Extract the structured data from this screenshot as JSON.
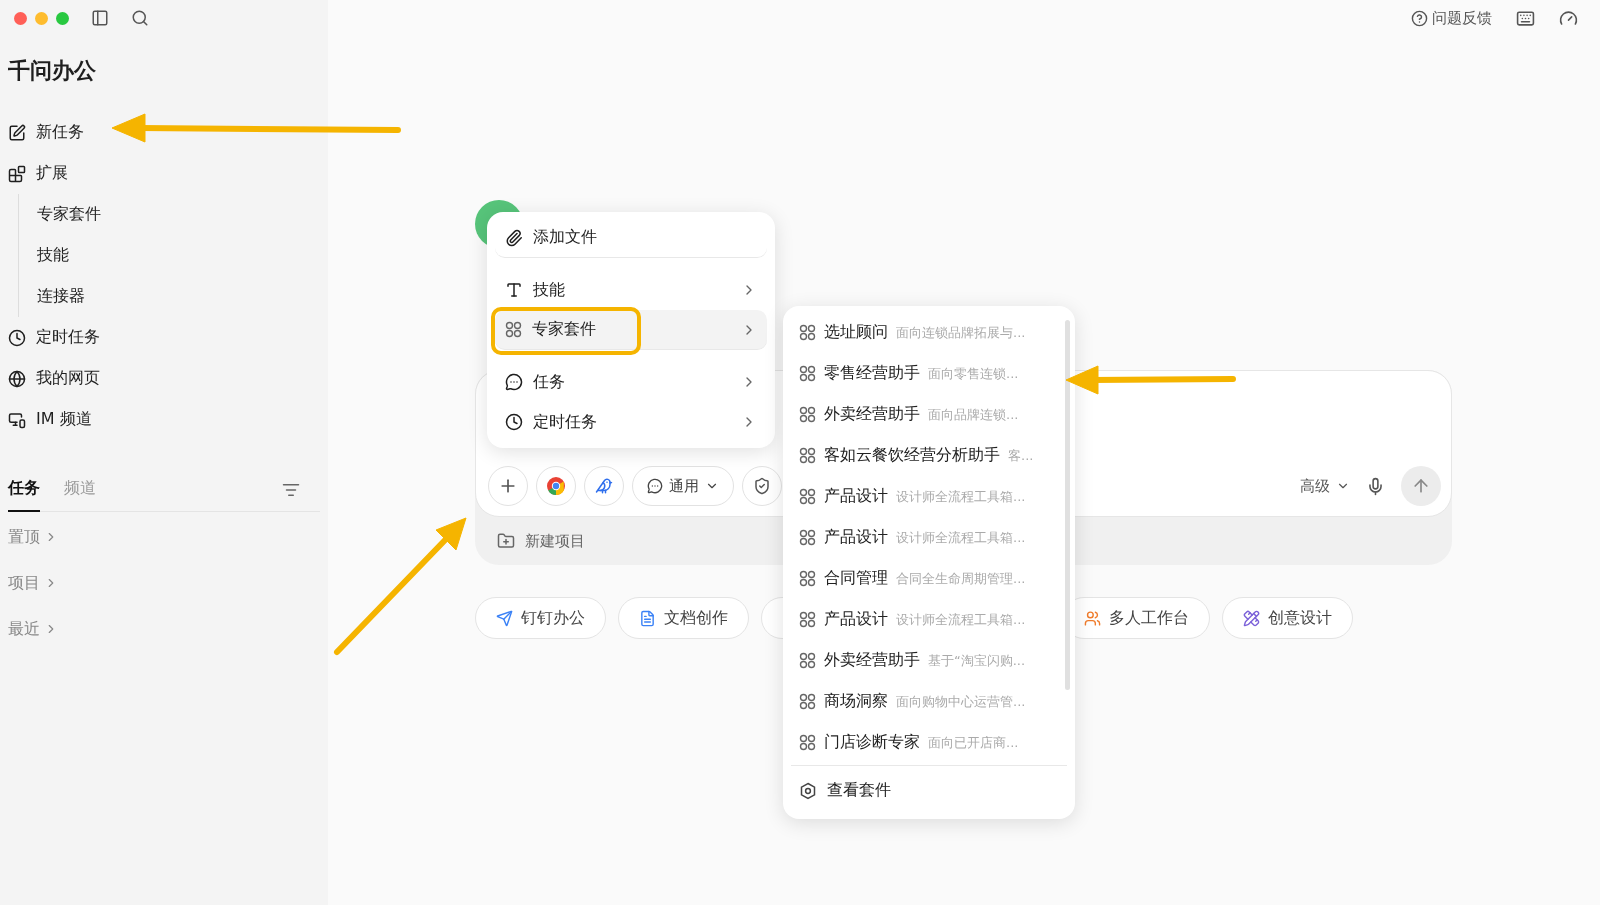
{
  "topbar": {
    "feedback": "问题反馈"
  },
  "app_title": "千问办公",
  "nav": [
    {
      "label": "新任务",
      "kind": "edit"
    },
    {
      "label": "扩展",
      "kind": "extensions",
      "children": [
        {
          "label": "专家套件"
        },
        {
          "label": "技能"
        },
        {
          "label": "连接器"
        }
      ]
    },
    {
      "label": "定时任务",
      "kind": "schedule"
    },
    {
      "label": "我的网页",
      "kind": "webpage"
    },
    {
      "label": "IM 频道",
      "kind": "im"
    }
  ],
  "list_tabs": [
    {
      "label": "任务",
      "selected": true
    },
    {
      "label": "频道",
      "selected": false
    }
  ],
  "groups": [
    "置顶",
    "项目",
    "最近"
  ],
  "composer": {
    "mode": "通用",
    "advanced": "高级",
    "project": "新建项目"
  },
  "menu": [
    {
      "label": "添加文件",
      "kind": "file",
      "submenu": false,
      "selected": false,
      "divider_after": true
    },
    {
      "label": "技能",
      "kind": "skill",
      "submenu": true,
      "selected": false,
      "divider_after": false
    },
    {
      "label": "专家套件",
      "kind": "suite",
      "submenu": true,
      "selected": true,
      "divider_after": true
    },
    {
      "label": "任务",
      "kind": "task",
      "submenu": true,
      "selected": false,
      "divider_after": false
    },
    {
      "label": "定时任务",
      "kind": "schedule",
      "submenu": true,
      "selected": false,
      "divider_after": false
    }
  ],
  "suites": {
    "items": [
      {
        "name": "选址顾问",
        "desc": "面向连锁品牌拓展与..."
      },
      {
        "name": "零售经营助手",
        "desc": "面向零售连锁..."
      },
      {
        "name": "外卖经营助手",
        "desc": "面向品牌连锁..."
      },
      {
        "name": "客如云餐饮经营分析助手",
        "desc": "客..."
      },
      {
        "name": "产品设计",
        "desc": "设计师全流程工具箱..."
      },
      {
        "name": "产品设计",
        "desc": "设计师全流程工具箱..."
      },
      {
        "name": "合同管理",
        "desc": "合同全生命周期管理..."
      },
      {
        "name": "产品设计",
        "desc": "设计师全流程工具箱..."
      },
      {
        "name": "外卖经营助手",
        "desc": "基于“淘宝闪购..."
      },
      {
        "name": "商场洞察",
        "desc": "面向购物中心运营管..."
      },
      {
        "name": "门店诊断专家",
        "desc": "面向已开店商..."
      }
    ],
    "footer": "查看套件"
  },
  "shortcuts": [
    {
      "label": "钉钉办公",
      "kind": "dingtalk"
    },
    {
      "label": "文档创作",
      "kind": "doc"
    },
    {
      "label": "多人工作台",
      "kind": "team"
    },
    {
      "label": "创意设计",
      "kind": "design"
    }
  ]
}
